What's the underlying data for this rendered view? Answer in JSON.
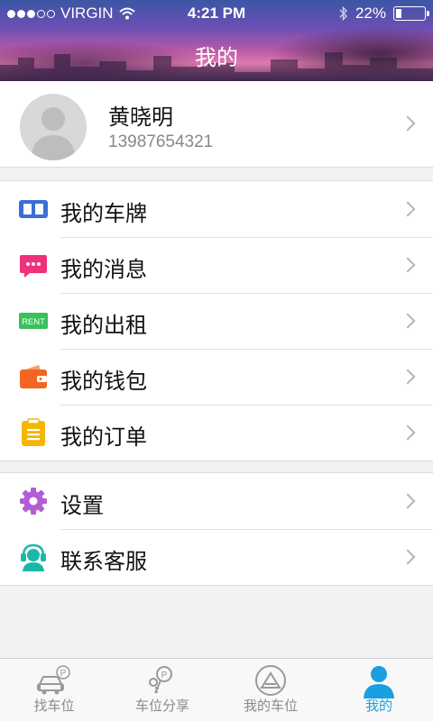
{
  "status_bar": {
    "carrier": "VIRGIN",
    "time": "4:21 PM",
    "battery": "22%",
    "battery_level": 0.22
  },
  "header": {
    "title": "我的"
  },
  "profile": {
    "name": "黄晓明",
    "phone": "13987654321"
  },
  "menu_group_1": [
    {
      "label": "我的车牌",
      "icon": "plate-icon",
      "color": "#3b6fd6"
    },
    {
      "label": "我的消息",
      "icon": "message-icon",
      "color": "#f0307a"
    },
    {
      "label": "我的出租",
      "icon": "rent-icon",
      "color": "#39c15a",
      "badge": "RENT"
    },
    {
      "label": "我的钱包",
      "icon": "wallet-icon",
      "color": "#f26522"
    },
    {
      "label": "我的订单",
      "icon": "order-icon",
      "color": "#f7b500"
    }
  ],
  "menu_group_2": [
    {
      "label": "设置",
      "icon": "gear-icon",
      "color": "#b45cd6"
    },
    {
      "label": "联系客服",
      "icon": "support-icon",
      "color": "#1bb8a8"
    }
  ],
  "tabbar": [
    {
      "label": "找车位",
      "icon": "find-parking-icon",
      "active": false
    },
    {
      "label": "车位分享",
      "icon": "share-parking-icon",
      "active": false
    },
    {
      "label": "我的车位",
      "icon": "my-parking-icon",
      "active": false
    },
    {
      "label": "我的",
      "icon": "profile-icon",
      "active": true
    }
  ],
  "colors": {
    "accent": "#1a9fe0",
    "inactive": "#8a8a8a"
  }
}
